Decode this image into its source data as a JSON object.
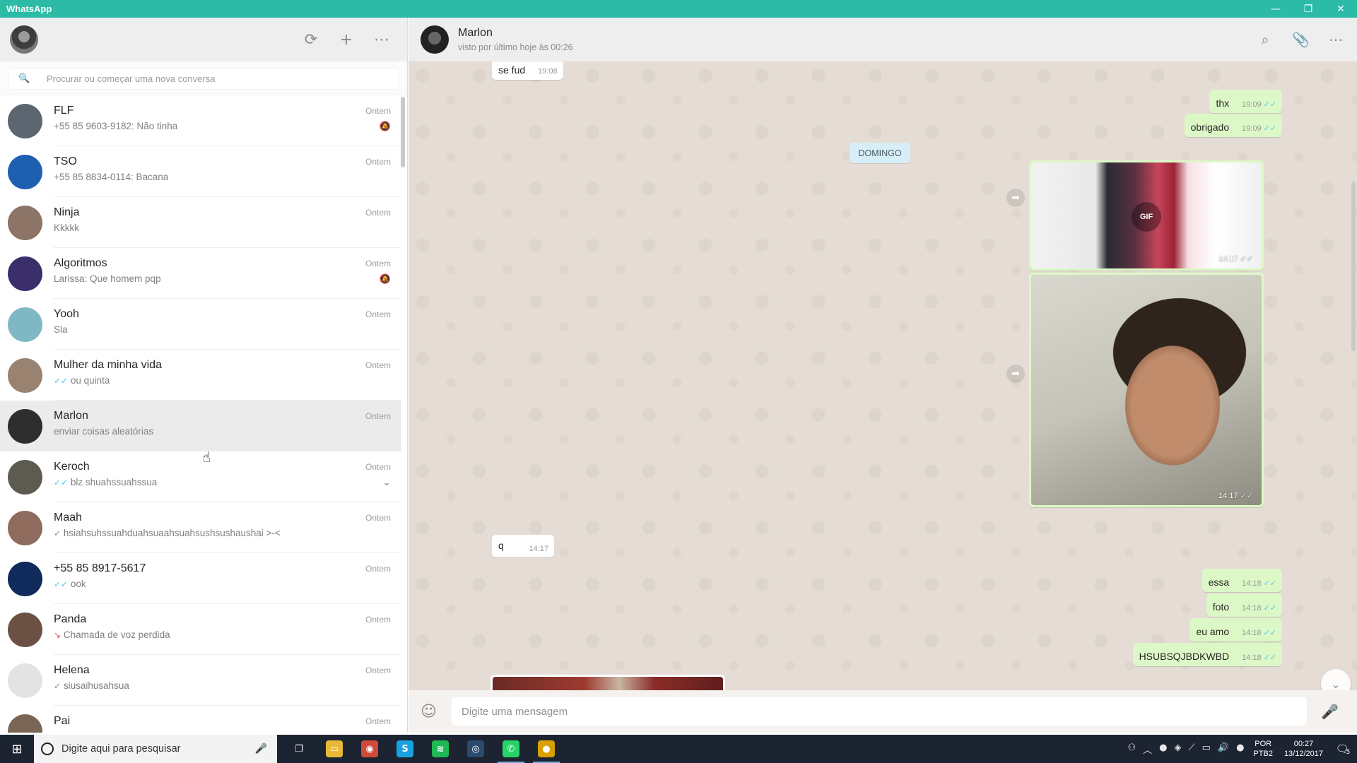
{
  "window": {
    "title": "WhatsApp",
    "controls": {
      "minimize": "—",
      "restore": "❐",
      "close": "✕"
    }
  },
  "sidebar": {
    "header_icons": [
      "status-icon",
      "new-chat-icon",
      "menu-icon"
    ],
    "header_glyphs": {
      "status": "⟳",
      "new_chat": "+",
      "menu": "⋯"
    },
    "search": {
      "placeholder": "Procurar ou começar uma nova conversa",
      "icon": "🔍"
    },
    "chats": [
      {
        "name": "FLF",
        "preview": "+55 85 9603-9182: Não tinha",
        "time": "Ontem",
        "muted": true,
        "avatar_color": "#5b6670"
      },
      {
        "name": "TSO",
        "preview": "+55 85 8834-0114: Bacana",
        "time": "Ontem",
        "muted": false,
        "avatar_color": "#1f5fb0"
      },
      {
        "name": "Ninja",
        "preview": "Kkkkk",
        "time": "Ontem",
        "muted": false,
        "avatar_color": "#8c7466"
      },
      {
        "name": "Algoritmos",
        "preview": "Larissa: Que homem pqp",
        "time": "Ontem",
        "muted": true,
        "avatar_color": "#3a2f6a"
      },
      {
        "name": "Yooh",
        "preview": "Sla",
        "time": "Ontem",
        "muted": false,
        "avatar_color": "#7fb8c4"
      },
      {
        "name": "Mulher da minha vida",
        "preview": "ou quinta",
        "tick": "✓✓",
        "tick_color": "blue",
        "time": "Ontem",
        "muted": false,
        "avatar_color": "#9a8271"
      },
      {
        "name": "Marlon",
        "preview": "enviar coisas aleatórias",
        "time": "Ontem",
        "muted": false,
        "active": true,
        "avatar_color": "#2e2e2e"
      },
      {
        "name": "Keroch",
        "preview": "blz shuahssuahssua",
        "tick": "✓✓",
        "tick_color": "blue",
        "time": "Ontem",
        "muted": false,
        "hover": true,
        "avatar_color": "#5d5a4f"
      },
      {
        "name": "Maah",
        "preview": "hsiahsuhssuahduahsuaahsuahsushsushaushai >-<",
        "tick": "✓",
        "tick_color": "gray",
        "time": "Ontem",
        "muted": false,
        "avatar_color": "#8e6b5c"
      },
      {
        "name": "+55 85 8917-5617",
        "preview": "ook",
        "tick": "✓✓",
        "tick_color": "blue",
        "time": "Ontem",
        "muted": false,
        "avatar_color": "#102a5c"
      },
      {
        "name": "Panda",
        "preview": "Chamada de voz perdida",
        "missed": "↘",
        "time": "Ontem",
        "muted": false,
        "avatar_color": "#6b5144"
      },
      {
        "name": "Helena",
        "preview": "siusaihusahsua",
        "tick": "✓",
        "tick_color": "gray",
        "time": "Ontem",
        "muted": false,
        "avatar_color": "#e3e3e3"
      },
      {
        "name": "Pai",
        "preview": "",
        "time": "Ontem",
        "muted": false,
        "avatar_color": "#7a6555"
      }
    ]
  },
  "conversation": {
    "contact_name": "Marlon",
    "status": "visto por último hoje às 00:26",
    "header_glyphs": {
      "search": "⌕",
      "attach": "📎",
      "menu": "⋯"
    },
    "date_divider": "DOMINGO",
    "messages": [
      {
        "dir": "in",
        "text": "se fud",
        "time": "19:08"
      },
      {
        "dir": "out",
        "text": "thx",
        "time": "19:09",
        "tick": "✓✓"
      },
      {
        "dir": "out",
        "text": "obrigado",
        "time": "19:09",
        "tick": "✓✓"
      },
      {
        "dir": "out",
        "type": "gif",
        "label": "GIF",
        "time": "14:17",
        "tick": "✓✓"
      },
      {
        "dir": "out",
        "type": "image",
        "time": "14:17",
        "tick": "✓✓"
      },
      {
        "dir": "in",
        "text": "q",
        "time": "14:17"
      },
      {
        "dir": "out",
        "text": "essa",
        "time": "14:18",
        "tick": "✓✓"
      },
      {
        "dir": "out",
        "text": "foto",
        "time": "14:18",
        "tick": "✓✓"
      },
      {
        "dir": "out",
        "text": "eu amo",
        "time": "14:18",
        "tick": "✓✓"
      },
      {
        "dir": "out",
        "text": "HSUBSQJBDKWBD",
        "time": "14:18",
        "tick": "✓✓"
      }
    ],
    "forward_glyph": "➦",
    "scroll_down_glyph": "⌄",
    "composer": {
      "placeholder": "Digite uma mensagem",
      "emoji_glyph": "☺",
      "mic_glyph": "🎤"
    }
  },
  "taskbar": {
    "start_glyph": "⊞",
    "search_text": "Digite aqui para pesquisar",
    "search_mic_glyph": "🎤",
    "apps": [
      {
        "name": "task-view",
        "glyph": "❐",
        "color": "transparent",
        "running": false
      },
      {
        "name": "file-explorer",
        "glyph": "▭",
        "color": "#e8b838",
        "running": false
      },
      {
        "name": "chrome",
        "glyph": "◉",
        "color": "#d04a3a",
        "running": false
      },
      {
        "name": "skype",
        "glyph": "S",
        "color": "#1aa1e1",
        "running": false
      },
      {
        "name": "spotify",
        "glyph": "≋",
        "color": "#1db954",
        "running": false
      },
      {
        "name": "steam",
        "glyph": "◎",
        "color": "#2a4a6e",
        "running": false
      },
      {
        "name": "whatsapp",
        "glyph": "✆",
        "color": "#25d366",
        "running": true
      },
      {
        "name": "app-yellow",
        "glyph": "●",
        "color": "#d8a000",
        "running": true
      }
    ],
    "tray_glyphs": [
      "⚇",
      "︿",
      "●",
      "◈",
      "⟋",
      "▭",
      "🔊",
      "●"
    ],
    "language": {
      "line1": "POR",
      "line2": "PTB2"
    },
    "clock": {
      "time": "00:27",
      "date": "13/12/2017"
    },
    "notification_glyph": "🗨",
    "notification_count": "5"
  },
  "cursor_glyph": "☝"
}
